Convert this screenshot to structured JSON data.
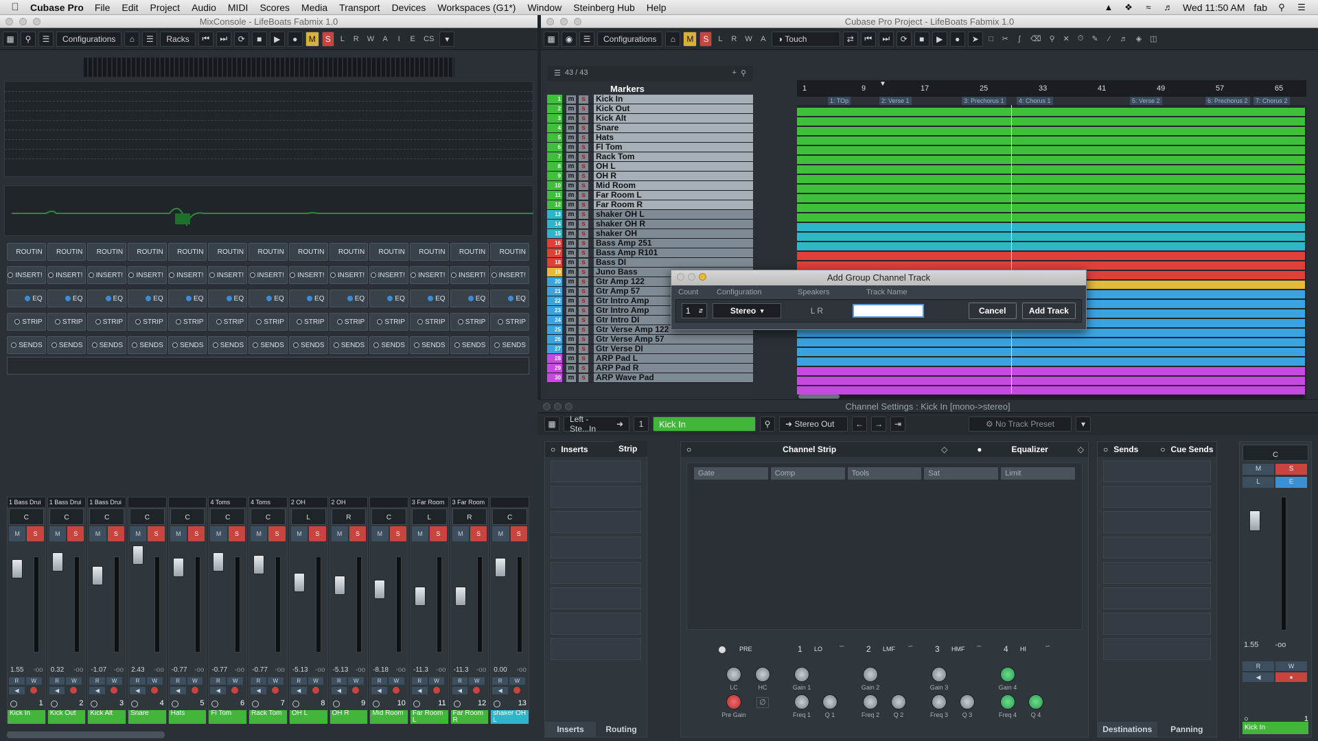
{
  "menubar": {
    "app": "Cubase Pro",
    "items": [
      "File",
      "Edit",
      "Project",
      "Audio",
      "MIDI",
      "Scores",
      "Media",
      "Transport",
      "Devices",
      "Workspaces (G1*)",
      "Window",
      "Steinberg Hub",
      "Help"
    ],
    "clock": "Wed 11:50 AM",
    "user": "fab"
  },
  "mix": {
    "title": "MixConsole - LifeBoats Fabmix 1.0",
    "configurations": "Configurations",
    "racks": "Racks",
    "rack_labels": {
      "routing": "ROUTIN",
      "inserts": "INSERT!",
      "eq": "EQ",
      "strip": "STRIP",
      "sends": "SENDS"
    },
    "channels": [
      {
        "group": "1 Bass Drui",
        "pan": "C",
        "value": "1.55",
        "peak": "-oo",
        "num": "1",
        "name": "Kick In"
      },
      {
        "group": "1 Bass Drui",
        "pan": "C",
        "value": "0.32",
        "peak": "-oo",
        "num": "2",
        "name": "Kick Out"
      },
      {
        "group": "1 Bass Drui",
        "pan": "C",
        "value": "-1.07",
        "peak": "-oo",
        "num": "3",
        "name": "Kick Alt"
      },
      {
        "group": "",
        "pan": "C",
        "value": "2.43",
        "peak": "-oo",
        "num": "4",
        "name": "Snare"
      },
      {
        "group": "",
        "pan": "C",
        "value": "-0.77",
        "peak": "-oo",
        "num": "5",
        "name": "Hats"
      },
      {
        "group": "4 Toms",
        "pan": "C",
        "value": "-0.77",
        "peak": "-oo",
        "num": "6",
        "name": "Fl Tom"
      },
      {
        "group": "4 Toms",
        "pan": "C",
        "value": "-0.77",
        "peak": "-oo",
        "num": "7",
        "name": "Rack Tom"
      },
      {
        "group": "2 OH",
        "pan": "L",
        "value": "-5.13",
        "peak": "-oo",
        "num": "8",
        "name": "OH L"
      },
      {
        "group": "2 OH",
        "pan": "R",
        "value": "-5.13",
        "peak": "-oo",
        "num": "9",
        "name": "OH R"
      },
      {
        "group": "",
        "pan": "C",
        "value": "-8.18",
        "peak": "-oo",
        "num": "10",
        "name": "Mid Room"
      },
      {
        "group": "3 Far Room",
        "pan": "L",
        "value": "-11.3",
        "peak": "-oo",
        "num": "11",
        "name": "Far Room L"
      },
      {
        "group": "3 Far Room",
        "pan": "R",
        "value": "-11.3",
        "peak": "-oo",
        "num": "12",
        "name": "Far Room R"
      },
      {
        "group": "",
        "pan": "C",
        "value": "0.00",
        "peak": "-oo",
        "num": "13",
        "name": "shaker OH L"
      }
    ]
  },
  "project": {
    "title": "Cubase Pro Project - LifeBoats Fabmix 1.0",
    "configurations": "Configurations",
    "automation_mode": "Touch",
    "track_count": "43 / 43",
    "markers_label": "Markers",
    "ruler": [
      "1",
      "9",
      "17",
      "25",
      "33",
      "41",
      "49",
      "57",
      "65"
    ],
    "marker_names": [
      "1: TOp",
      "2: Verse 1",
      "3: Prechorus 1",
      "4: Chorus 1",
      "5: Verse 2",
      "6: Prechorus 2",
      "7: Chorus 2"
    ],
    "tracks": [
      {
        "n": "1",
        "name": "Kick In",
        "color": "#3fbf3a"
      },
      {
        "n": "2",
        "name": "Kick Out",
        "color": "#3fbf3a"
      },
      {
        "n": "3",
        "name": "Kick Alt",
        "color": "#3fbf3a"
      },
      {
        "n": "4",
        "name": "Snare",
        "color": "#3fbf3a"
      },
      {
        "n": "5",
        "name": "Hats",
        "color": "#3fbf3a"
      },
      {
        "n": "6",
        "name": "Fl Tom",
        "color": "#3fbf3a"
      },
      {
        "n": "7",
        "name": "Rack Tom",
        "color": "#3fbf3a"
      },
      {
        "n": "8",
        "name": "OH L",
        "color": "#3fbf3a"
      },
      {
        "n": "9",
        "name": "OH R",
        "color": "#3fbf3a"
      },
      {
        "n": "10",
        "name": "Mid Room",
        "color": "#3fbf3a"
      },
      {
        "n": "11",
        "name": "Far Room L",
        "color": "#3fbf3a"
      },
      {
        "n": "12",
        "name": "Far Room R",
        "color": "#3fbf3a"
      },
      {
        "n": "13",
        "name": "shaker OH L",
        "color": "#2fb5c8"
      },
      {
        "n": "14",
        "name": "shaker OH R",
        "color": "#2fb5c8"
      },
      {
        "n": "15",
        "name": "shaker OH",
        "color": "#2fb5c8"
      },
      {
        "n": "16",
        "name": "Bass Amp 251",
        "color": "#e0403a"
      },
      {
        "n": "17",
        "name": "Bass Amp R101",
        "color": "#e0403a"
      },
      {
        "n": "18",
        "name": "Bass DI",
        "color": "#e0403a"
      },
      {
        "n": "19",
        "name": "Juno Bass",
        "color": "#e6b93a"
      },
      {
        "n": "20",
        "name": "Gtr Amp 122",
        "color": "#3aa4e0"
      },
      {
        "n": "21",
        "name": "Gtr Amp 57",
        "color": "#3aa4e0"
      },
      {
        "n": "22",
        "name": "Gtr Intro Amp",
        "color": "#3aa4e0"
      },
      {
        "n": "23",
        "name": "Gtr Intro Amp",
        "color": "#3aa4e0"
      },
      {
        "n": "24",
        "name": "Gtr Intro DI",
        "color": "#3aa4e0"
      },
      {
        "n": "25",
        "name": "Gtr Verse Amp 122",
        "color": "#3aa4e0"
      },
      {
        "n": "26",
        "name": "Gtr Verse Amp 57",
        "color": "#3aa4e0"
      },
      {
        "n": "27",
        "name": "Gtr Verse DI",
        "color": "#3aa4e0"
      },
      {
        "n": "28",
        "name": "ARP Pad L",
        "color": "#c44ae0"
      },
      {
        "n": "29",
        "name": "ARP Pad R",
        "color": "#c44ae0"
      },
      {
        "n": "30",
        "name": "ARP Wave Pad",
        "color": "#c44ae0"
      }
    ]
  },
  "dialog": {
    "title": "Add Group Channel Track",
    "col_count": "Count",
    "col_config": "Configuration",
    "col_speakers": "Speakers",
    "col_name": "Track Name",
    "count": "1",
    "configuration": "Stereo",
    "speakers": "L R",
    "track_name": "",
    "cancel": "Cancel",
    "add": "Add Track"
  },
  "chs": {
    "title": "Channel Settings : Kick In [mono->stereo]",
    "input": "Left - Ste...In",
    "channel_num": "1",
    "channel_name": "Kick In",
    "output": "Stereo Out",
    "preset": "No Track Preset",
    "inserts": "Inserts",
    "strip": "Strip",
    "channel_strip": "Channel Strip",
    "equalizer": "Equalizer",
    "sends": "Sends",
    "cue_sends": "Cue Sends",
    "strip_modules": [
      "Gate",
      "Comp",
      "Tools",
      "Sat",
      "Limit"
    ],
    "bottom_tabs": [
      "Inserts",
      "Routing"
    ],
    "sends_tabs": [
      "Destinations",
      "Panning"
    ],
    "eq_bands": [
      {
        "n": "1",
        "type": "LO"
      },
      {
        "n": "2",
        "type": "LMF"
      },
      {
        "n": "3",
        "type": "HMF"
      },
      {
        "n": "4",
        "type": "HI"
      }
    ],
    "pre": "PRE",
    "knobs": {
      "lc": "LC",
      "hc": "HC",
      "pregain": "Pre Gain",
      "gain1": "Gain 1",
      "gain2": "Gain 2",
      "gain3": "Gain 3",
      "gain4": "Gain 4",
      "freq1": "Freq 1",
      "freq2": "Freq 2",
      "freq3": "Freq 3",
      "freq4": "Freq 4",
      "q1": "Q 1",
      "q2": "Q 2",
      "q3": "Q 3",
      "q4": "Q 4"
    },
    "fader_value": "1.55",
    "fader_peak": "-oo",
    "mini_pan": "C",
    "mini_num": "1",
    "mini_name": "Kick In"
  }
}
